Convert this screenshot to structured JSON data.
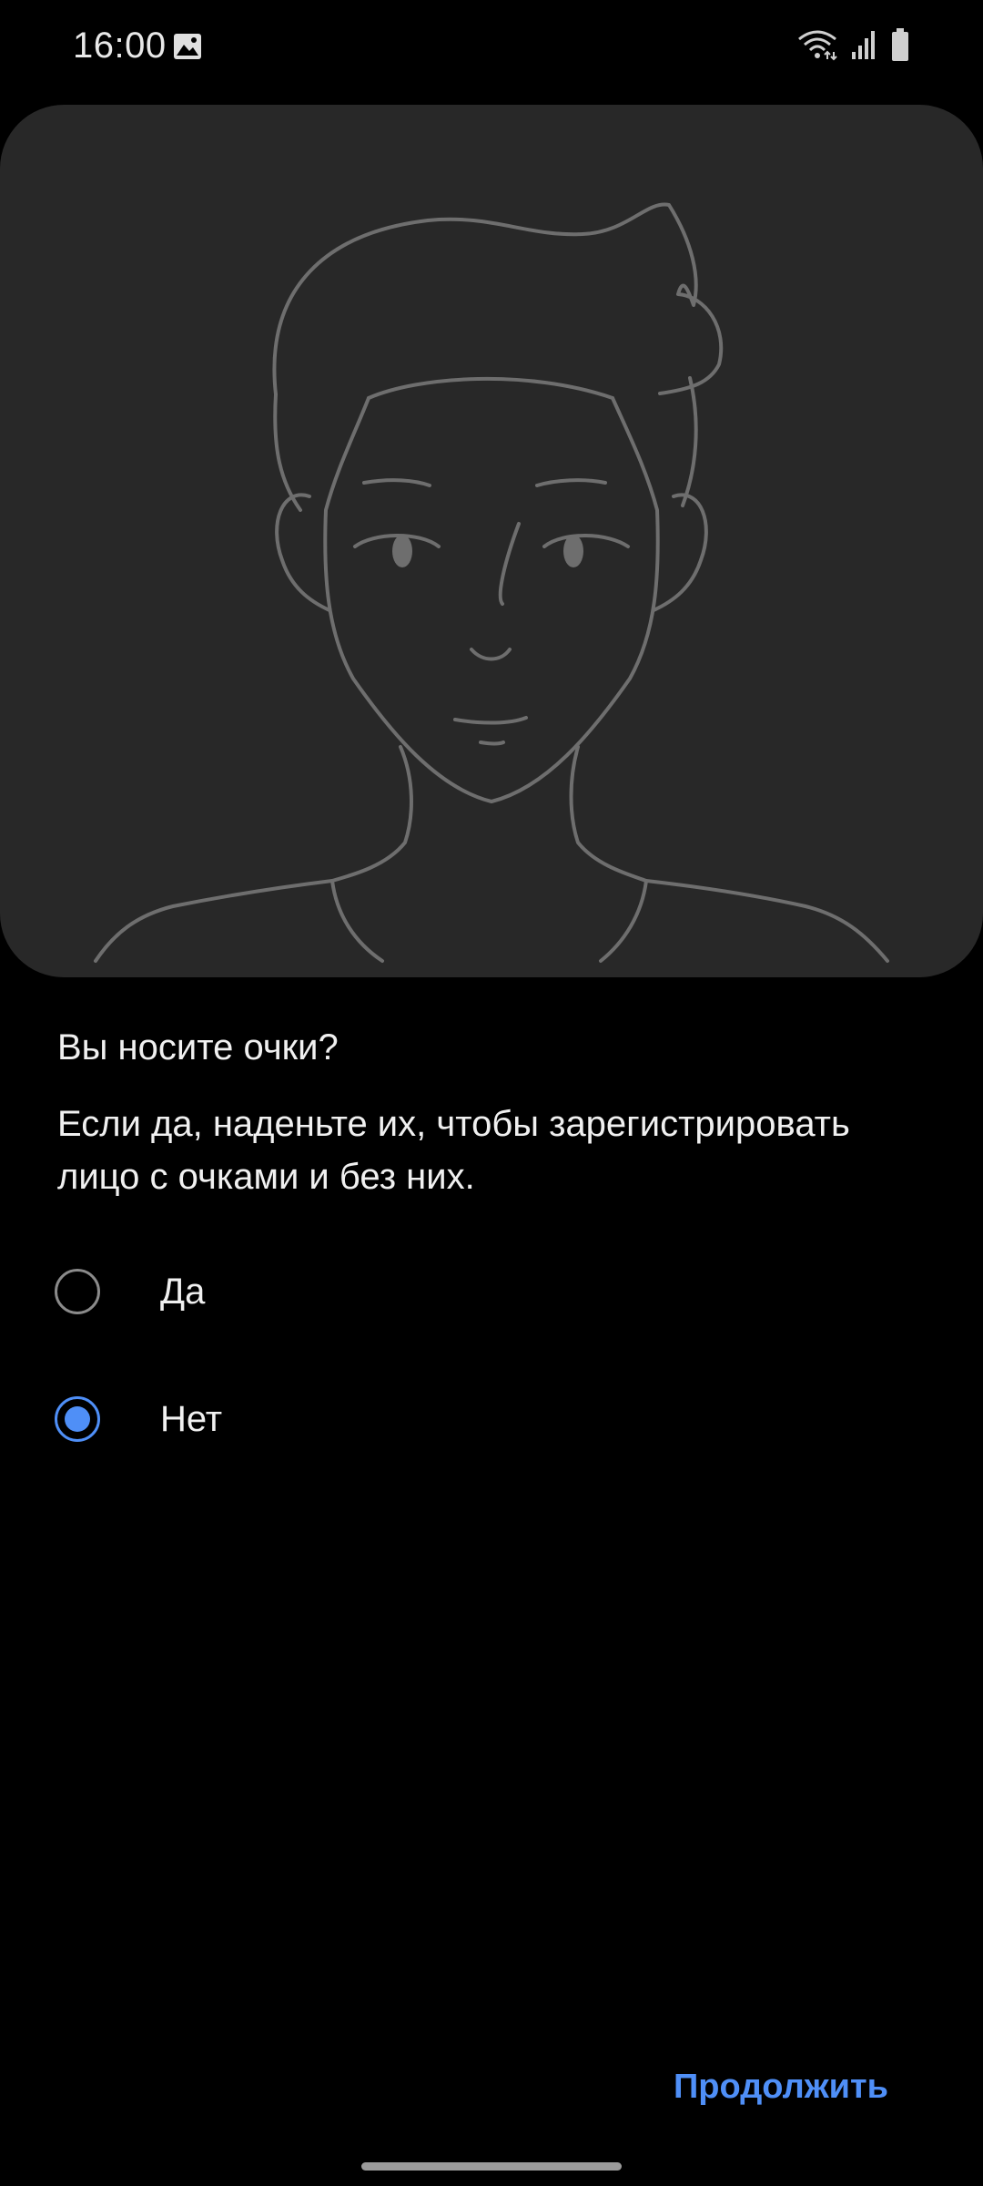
{
  "status_bar": {
    "time": "16:00",
    "icons": [
      "gallery-icon",
      "wifi-icon",
      "signal-icon",
      "battery-icon"
    ]
  },
  "illustration": {
    "icon": "face-outline-illustration"
  },
  "content": {
    "question": "Вы носите очки?",
    "description": "Если да, наденьте их, чтобы зарегистрировать лицо с очками и без них."
  },
  "options": [
    {
      "label": "Да",
      "selected": false
    },
    {
      "label": "Нет",
      "selected": true
    }
  ],
  "footer": {
    "continue_label": "Продолжить"
  },
  "colors": {
    "accent": "#4f8ff7",
    "card": "#282828",
    "background": "#000000"
  }
}
